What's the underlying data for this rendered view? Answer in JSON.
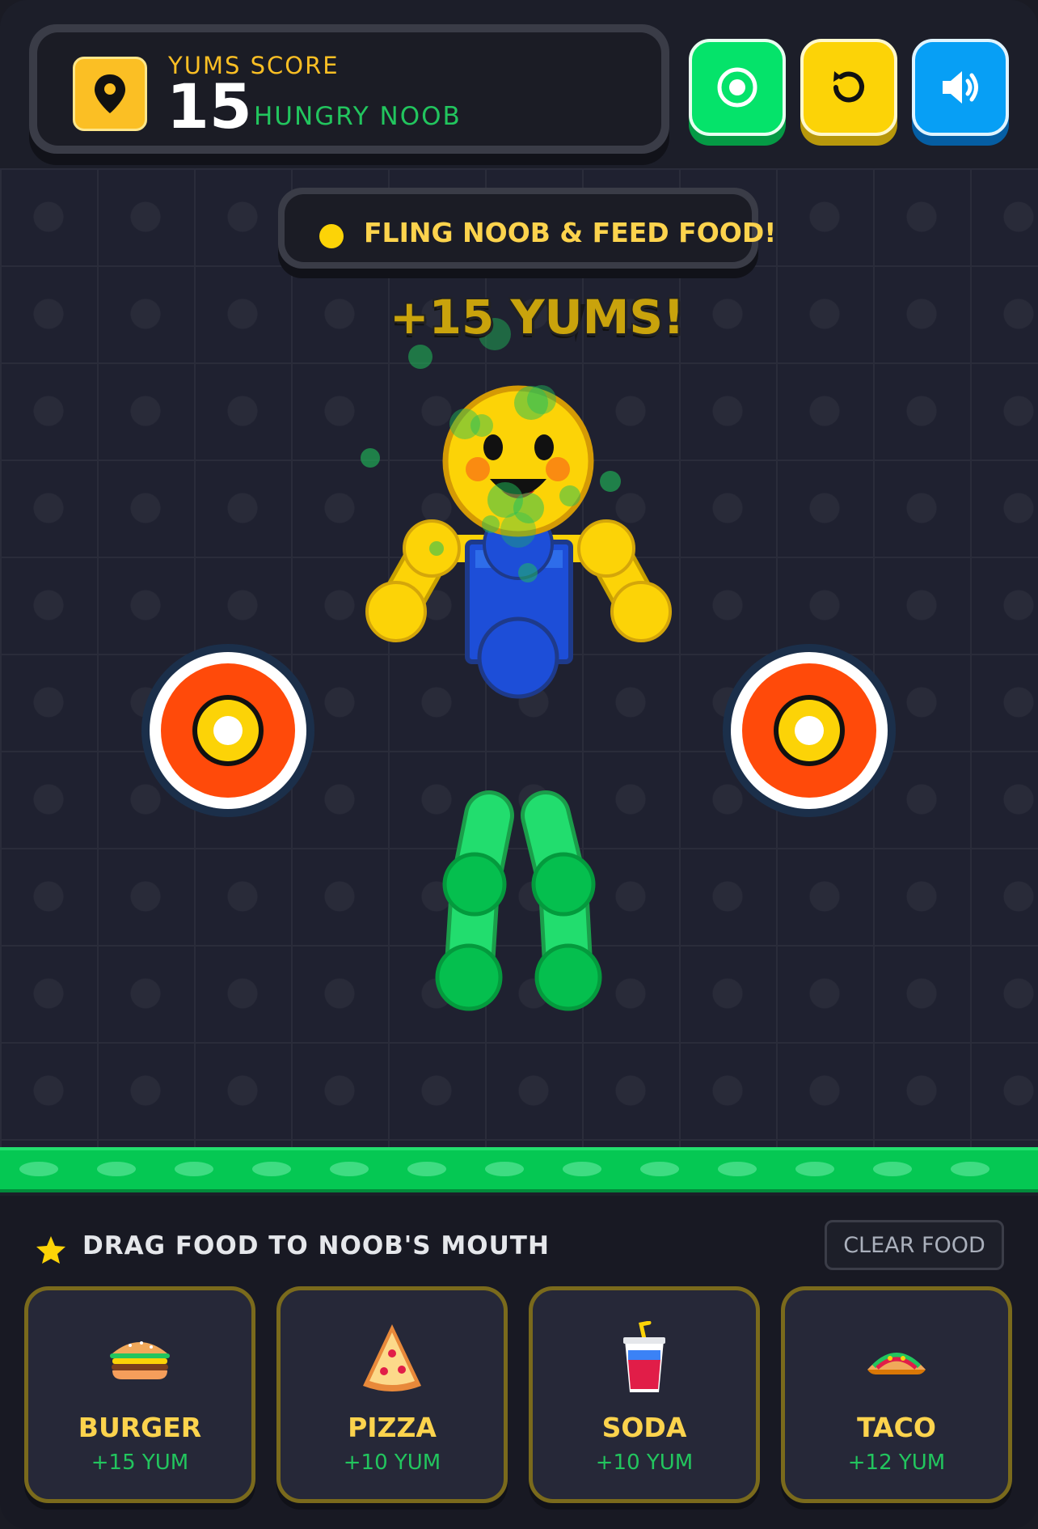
{
  "header": {
    "score_label": "YUMS SCORE",
    "score_value": "15",
    "rank_label": "HUNGRY NOOB",
    "icons": {
      "score": "map-pin-icon",
      "target_button": "target-icon",
      "restart_button": "restart-icon",
      "sound_button": "speaker-icon"
    }
  },
  "play_area": {
    "banner_text": "FLING NOOB & FEED FOOD!",
    "floating_text": "+15 YUMS!"
  },
  "footer": {
    "instruction": "DRAG FOOD TO NOOB'S MOUTH",
    "clear_label": "CLEAR FOOD",
    "foods": [
      {
        "name": "BURGER",
        "value": "+15 YUM",
        "icon": "burger-icon"
      },
      {
        "name": "PIZZA",
        "value": "+10 YUM",
        "icon": "pizza-icon"
      },
      {
        "name": "SODA",
        "value": "+10 YUM",
        "icon": "soda-icon"
      },
      {
        "name": "TACO",
        "value": "+12 YUM",
        "icon": "taco-icon"
      }
    ]
  },
  "colors": {
    "accent_yellow": "#fcd307",
    "accent_green": "#05e36a",
    "accent_blue": "#079ff5",
    "target_red": "#ff4a0a",
    "noob_blue": "#1d4ed8",
    "noob_yellow": "#fcd307",
    "noob_green": "#22c55e"
  }
}
